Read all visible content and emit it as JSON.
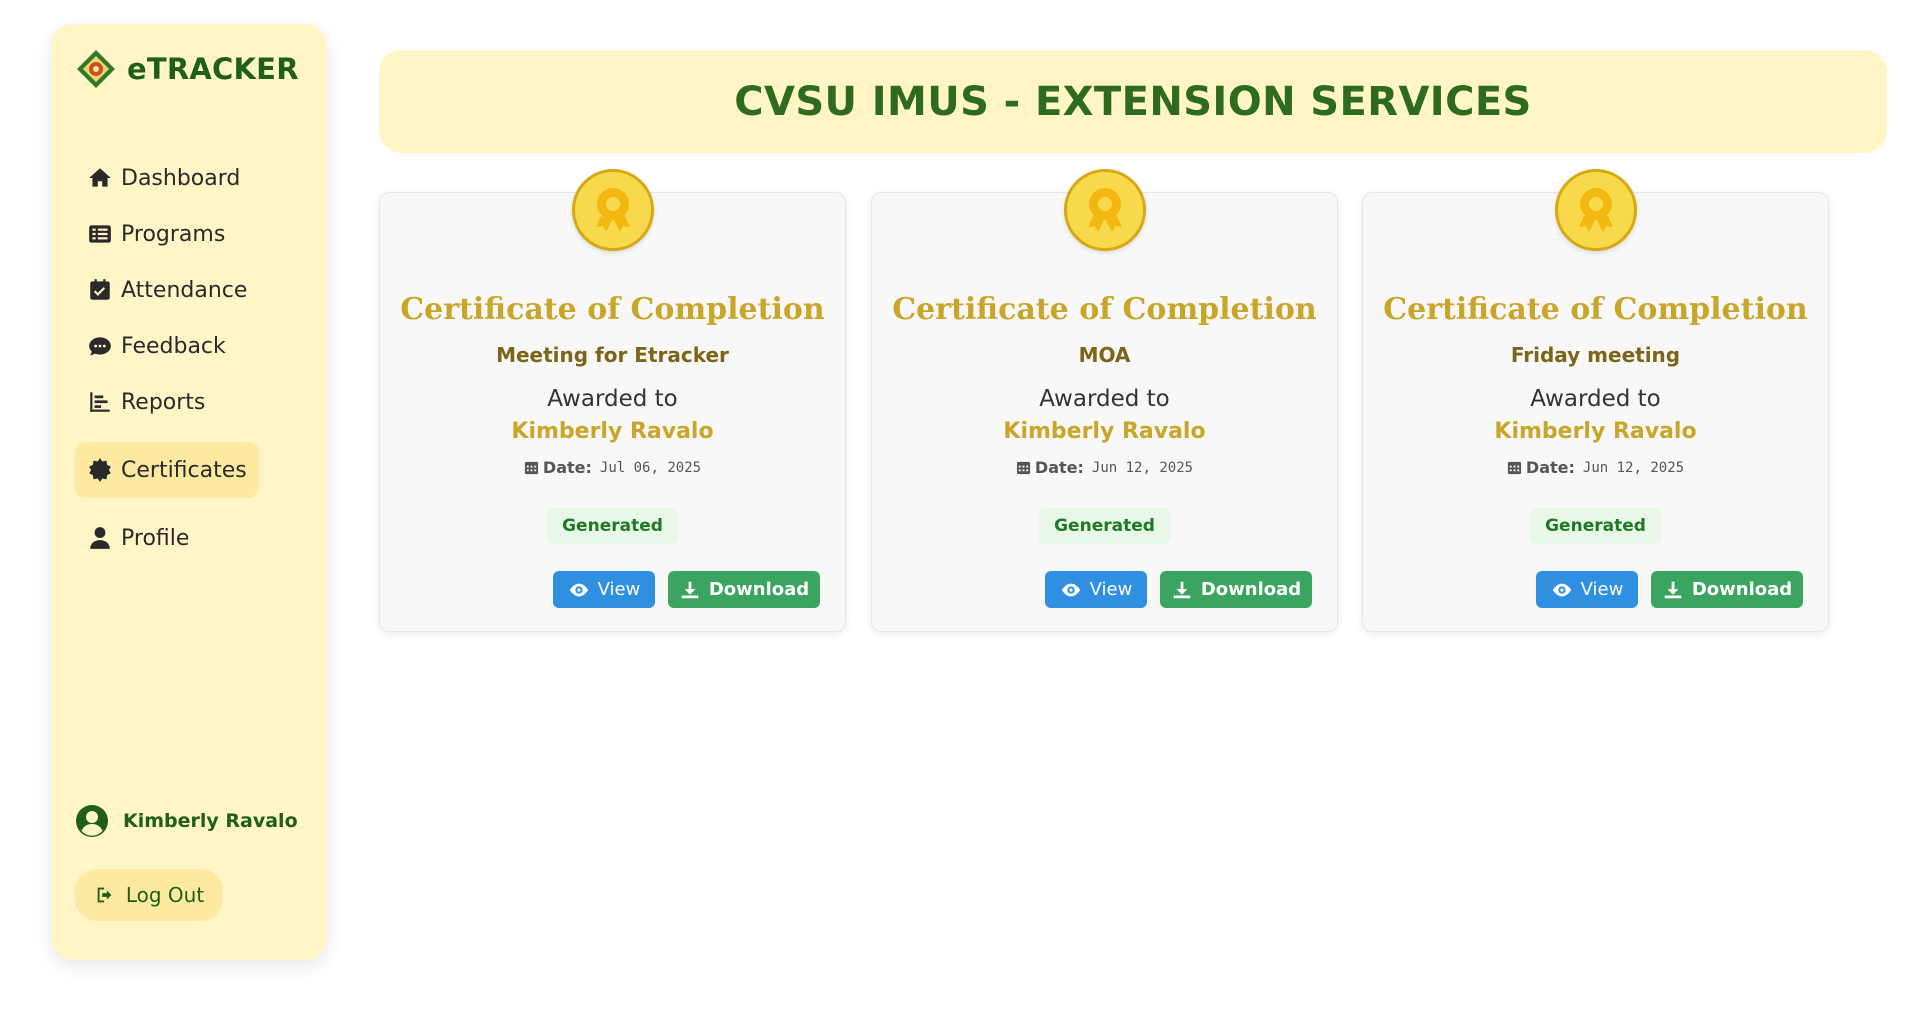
{
  "app": {
    "title": "eTRACKER"
  },
  "sidebar": {
    "items": [
      {
        "label": "Dashboard",
        "icon": "home-icon",
        "active": false
      },
      {
        "label": "Programs",
        "icon": "list-icon",
        "active": false
      },
      {
        "label": "Attendance",
        "icon": "calendar-check-icon",
        "active": false
      },
      {
        "label": "Feedback",
        "icon": "comment-icon",
        "active": false
      },
      {
        "label": "Reports",
        "icon": "chart-bar-icon",
        "active": false
      },
      {
        "label": "Certificates",
        "icon": "badge-icon",
        "active": true
      },
      {
        "label": "Profile",
        "icon": "user-icon",
        "active": false
      }
    ]
  },
  "user": {
    "name": "Kimberly Ravalo"
  },
  "logout": {
    "label": "Log Out"
  },
  "header": {
    "title": "CVSU IMUS - EXTENSION SERVICES"
  },
  "certificates": [
    {
      "title": "Certificate of Completion",
      "program": "Meeting for Etracker",
      "awarded_text": "Awarded to",
      "recipient": "Kimberly Ravalo",
      "date_label": "Date:",
      "date": "Jul 06, 2025",
      "status": "Generated",
      "view_label": "View",
      "download_label": "Download"
    },
    {
      "title": "Certificate of Completion",
      "program": "MOA",
      "awarded_text": "Awarded to",
      "recipient": "Kimberly Ravalo",
      "date_label": "Date:",
      "date": "Jun 12, 2025",
      "status": "Generated",
      "view_label": "View",
      "download_label": "Download"
    },
    {
      "title": "Certificate of Completion",
      "program": "Friday meeting",
      "awarded_text": "Awarded to",
      "recipient": "Kimberly Ravalo",
      "date_label": "Date:",
      "date": "Jun 12, 2025",
      "status": "Generated",
      "view_label": "View",
      "download_label": "Download"
    }
  ],
  "colors": {
    "sidebar_bg": "#fff5c6",
    "active_bg": "#fdeaa0",
    "brand_green": "#1f5f16",
    "gold": "#c9a52a",
    "view_blue": "#2f8fe0",
    "download_green": "#3aa460"
  }
}
